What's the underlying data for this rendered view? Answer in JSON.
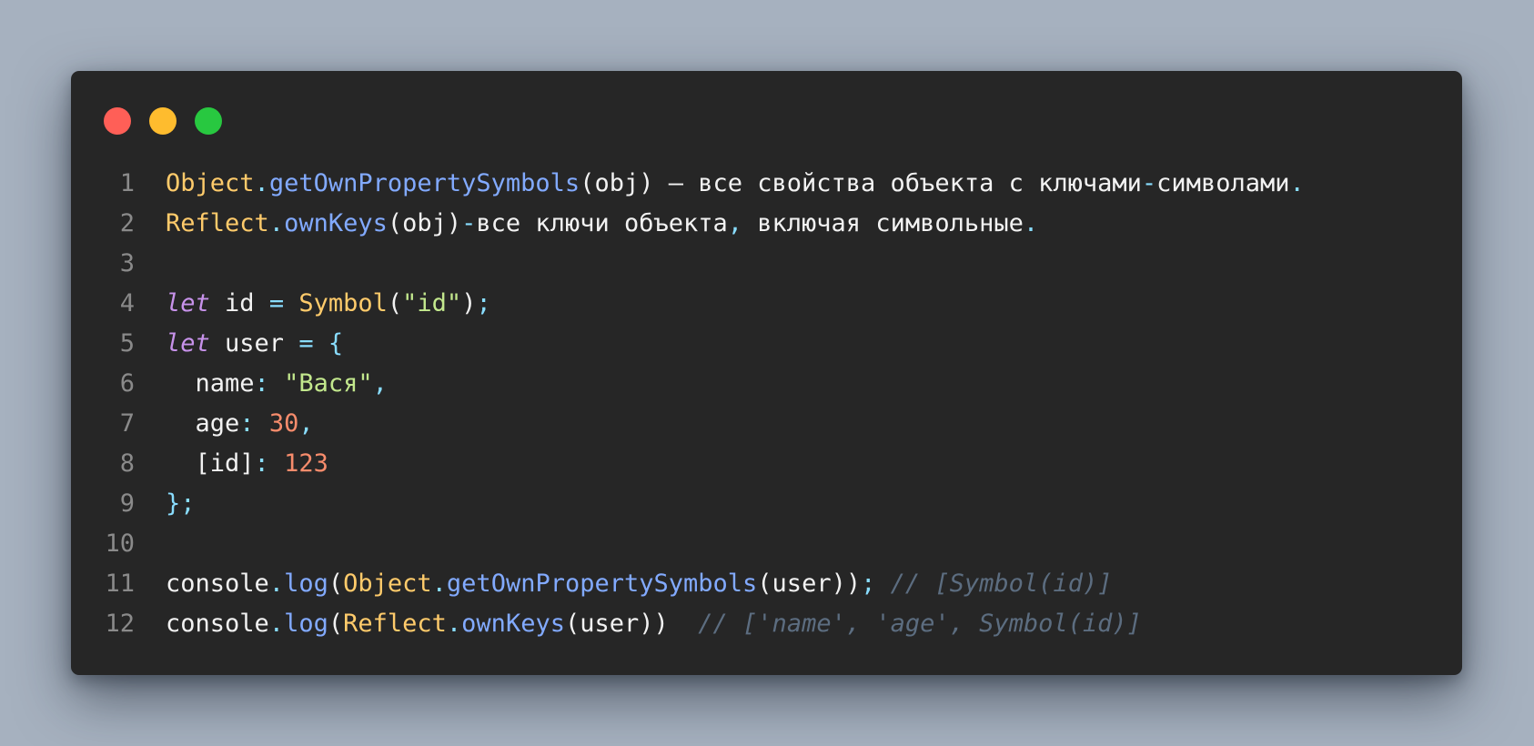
{
  "window": {
    "controls": [
      {
        "name": "close",
        "color": "#ff5f57"
      },
      {
        "name": "minimize",
        "color": "#febc2e"
      },
      {
        "name": "maximize",
        "color": "#28c840"
      }
    ]
  },
  "colors": {
    "plain": "#f2f2f2",
    "class": "#ffcb6b",
    "method": "#82aaff",
    "punct": "#89ddff",
    "keyword": "#c792ea",
    "string": "#c3e88d",
    "number": "#f78c6c",
    "comment": "#5c6d80",
    "line_number": "#8a8a8a"
  },
  "code": {
    "lines": [
      {
        "number": "1",
        "tokens": [
          {
            "text": "Object",
            "type": "class"
          },
          {
            "text": ".",
            "type": "punct"
          },
          {
            "text": "getOwnPropertySymbols",
            "type": "method"
          },
          {
            "text": "(obj) – все свойства объекта с ключами",
            "type": "plain"
          },
          {
            "text": "-",
            "type": "punct"
          },
          {
            "text": "символами",
            "type": "plain"
          },
          {
            "text": ".",
            "type": "punct"
          }
        ]
      },
      {
        "number": "2",
        "tokens": [
          {
            "text": "Reflect",
            "type": "class"
          },
          {
            "text": ".",
            "type": "punct"
          },
          {
            "text": "ownKeys",
            "type": "method"
          },
          {
            "text": "(obj)",
            "type": "plain"
          },
          {
            "text": "-",
            "type": "punct"
          },
          {
            "text": "все ключи объекта",
            "type": "plain"
          },
          {
            "text": ",",
            "type": "punct"
          },
          {
            "text": " включая символьные",
            "type": "plain"
          },
          {
            "text": ".",
            "type": "punct"
          }
        ]
      },
      {
        "number": "3",
        "tokens": []
      },
      {
        "number": "4",
        "tokens": [
          {
            "text": "let",
            "type": "keyword"
          },
          {
            "text": " id ",
            "type": "plain"
          },
          {
            "text": "=",
            "type": "punct"
          },
          {
            "text": " ",
            "type": "plain"
          },
          {
            "text": "Symbol",
            "type": "class"
          },
          {
            "text": "(",
            "type": "plain"
          },
          {
            "text": "\"id\"",
            "type": "string"
          },
          {
            "text": ")",
            "type": "plain"
          },
          {
            "text": ";",
            "type": "punct"
          }
        ]
      },
      {
        "number": "5",
        "tokens": [
          {
            "text": "let",
            "type": "keyword"
          },
          {
            "text": " user ",
            "type": "plain"
          },
          {
            "text": "=",
            "type": "punct"
          },
          {
            "text": " ",
            "type": "plain"
          },
          {
            "text": "{",
            "type": "punct"
          }
        ]
      },
      {
        "number": "6",
        "tokens": [
          {
            "text": "  name",
            "type": "plain"
          },
          {
            "text": ":",
            "type": "punct"
          },
          {
            "text": " ",
            "type": "plain"
          },
          {
            "text": "\"Вася\"",
            "type": "string"
          },
          {
            "text": ",",
            "type": "punct"
          }
        ]
      },
      {
        "number": "7",
        "tokens": [
          {
            "text": "  age",
            "type": "plain"
          },
          {
            "text": ":",
            "type": "punct"
          },
          {
            "text": " ",
            "type": "plain"
          },
          {
            "text": "30",
            "type": "number"
          },
          {
            "text": ",",
            "type": "punct"
          }
        ]
      },
      {
        "number": "8",
        "tokens": [
          {
            "text": "  [id]",
            "type": "plain"
          },
          {
            "text": ":",
            "type": "punct"
          },
          {
            "text": " ",
            "type": "plain"
          },
          {
            "text": "123",
            "type": "number"
          }
        ]
      },
      {
        "number": "9",
        "tokens": [
          {
            "text": "};",
            "type": "punct"
          }
        ]
      },
      {
        "number": "10",
        "tokens": []
      },
      {
        "number": "11",
        "tokens": [
          {
            "text": "console",
            "type": "plain"
          },
          {
            "text": ".",
            "type": "punct"
          },
          {
            "text": "log",
            "type": "method"
          },
          {
            "text": "(",
            "type": "plain"
          },
          {
            "text": "Object",
            "type": "class"
          },
          {
            "text": ".",
            "type": "punct"
          },
          {
            "text": "getOwnPropertySymbols",
            "type": "method"
          },
          {
            "text": "(user))",
            "type": "plain"
          },
          {
            "text": ";",
            "type": "punct"
          },
          {
            "text": " ",
            "type": "plain"
          },
          {
            "text": "// [Symbol(id)]",
            "type": "comment"
          }
        ]
      },
      {
        "number": "12",
        "tokens": [
          {
            "text": "console",
            "type": "plain"
          },
          {
            "text": ".",
            "type": "punct"
          },
          {
            "text": "log",
            "type": "method"
          },
          {
            "text": "(",
            "type": "plain"
          },
          {
            "text": "Reflect",
            "type": "class"
          },
          {
            "text": ".",
            "type": "punct"
          },
          {
            "text": "ownKeys",
            "type": "method"
          },
          {
            "text": "(user))  ",
            "type": "plain"
          },
          {
            "text": "// ['name', 'age', Symbol(id)]",
            "type": "comment"
          }
        ]
      }
    ]
  }
}
